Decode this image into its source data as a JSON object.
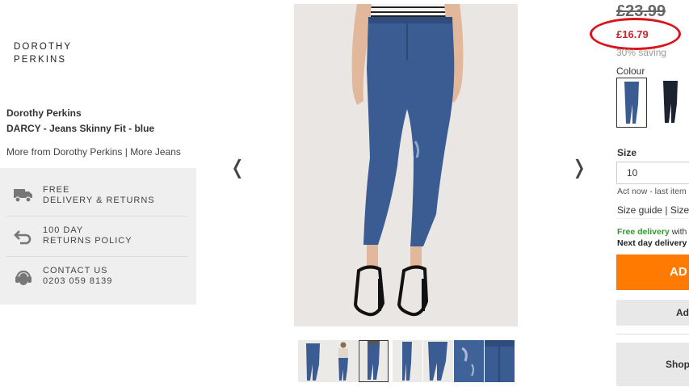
{
  "brand": {
    "logo_line1": "DOROTHY",
    "logo_line2": "PERKINS"
  },
  "product": {
    "brand_name": "Dorothy Perkins",
    "name": "DARCY - Jeans Skinny Fit - blue",
    "more_from_brand": "More from Dorothy Perkins",
    "separator": "|",
    "more_category": "More Jeans"
  },
  "services": [
    {
      "icon": "truck-icon",
      "line1": "FREE",
      "line2": "DELIVERY & RETURNS"
    },
    {
      "icon": "return-arrow-icon",
      "line1": "100 DAY",
      "line2": "RETURNS POLICY"
    },
    {
      "icon": "headset-icon",
      "line1": "CONTACT US",
      "line2": "0203 059 8139"
    }
  ],
  "gallery": {
    "prev": "❬",
    "next": "❭",
    "thumbnail_count": 7,
    "selected_thumbnail": 3
  },
  "pricing": {
    "old_price": "£23.99",
    "new_price": "£16.79",
    "saving": "30% saving"
  },
  "colour": {
    "label": "Colour",
    "options": [
      "blue",
      "black"
    ],
    "selected": "blue"
  },
  "size": {
    "label": "Size",
    "selected": "10",
    "stock_note": "Act now - last item",
    "guide_link": "Size guide",
    "separator": "|",
    "size_link": "Size"
  },
  "delivery": {
    "free_label": "Free delivery",
    "free_rest": "with",
    "next_day": "Next day delivery"
  },
  "buttons": {
    "add": "AD",
    "add_secondary": "Ad",
    "shop": "Shop"
  },
  "colors": {
    "accent_orange": "#ff7a00",
    "sale_red": "#c8262e",
    "highlight_ring": "#d9141a",
    "denim": "#3a5c93"
  }
}
